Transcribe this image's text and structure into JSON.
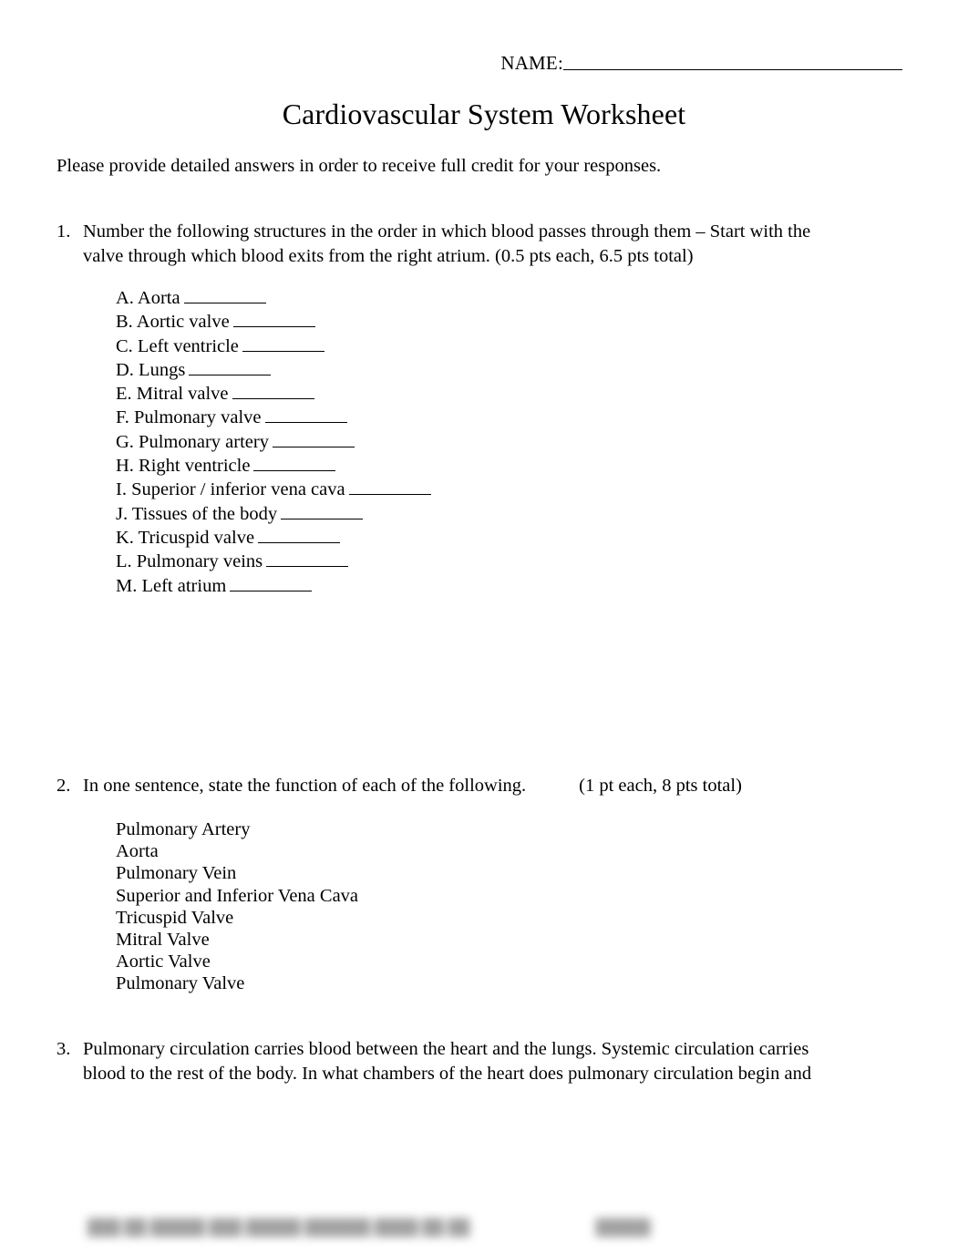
{
  "header": {
    "name_label": "NAME:"
  },
  "title": "Cardiovascular System Worksheet",
  "intro": "Please provide detailed answers in order to receive full credit for your responses.",
  "questions": [
    {
      "number": "1.",
      "line1": "Number the following structures in the order in which blood passes through them – Start with the",
      "line2": "valve through which blood exits from the right atrium. (0.5 pts each, 6.5 pts total)"
    },
    {
      "number": "2.",
      "line1": "In one sentence, state the function of each of the following.",
      "points": "(1 pt each, 8 pts total)"
    },
    {
      "number": "3.",
      "line1": "Pulmonary circulation carries blood between the heart and the lungs. Systemic circulation carries",
      "line2": "blood to the rest of the body. In what chambers of the heart does pulmonary circulation begin and"
    }
  ],
  "q1_items": [
    "A. Aorta",
    "B. Aortic valve",
    "C. Left ventricle",
    "D. Lungs",
    "E. Mitral valve",
    "F. Pulmonary valve",
    "G. Pulmonary artery",
    "H. Right ventricle",
    "I. Superior / inferior vena cava",
    "J. Tissues of the body",
    "K. Tricuspid valve",
    "L. Pulmonary veins",
    "M. Left atrium"
  ],
  "q2_items": [
    "Pulmonary Artery",
    "Aorta",
    "Pulmonary Vein",
    "Superior and Inferior Vena Cava",
    "Tricuspid Valve",
    "Mitral Valve",
    "Aortic Valve",
    "Pulmonary Valve"
  ],
  "footer": {
    "redacted_left": "███ ██ █████ ███ █████ ██████ ████ ██ ██",
    "redacted_right": "█████"
  }
}
